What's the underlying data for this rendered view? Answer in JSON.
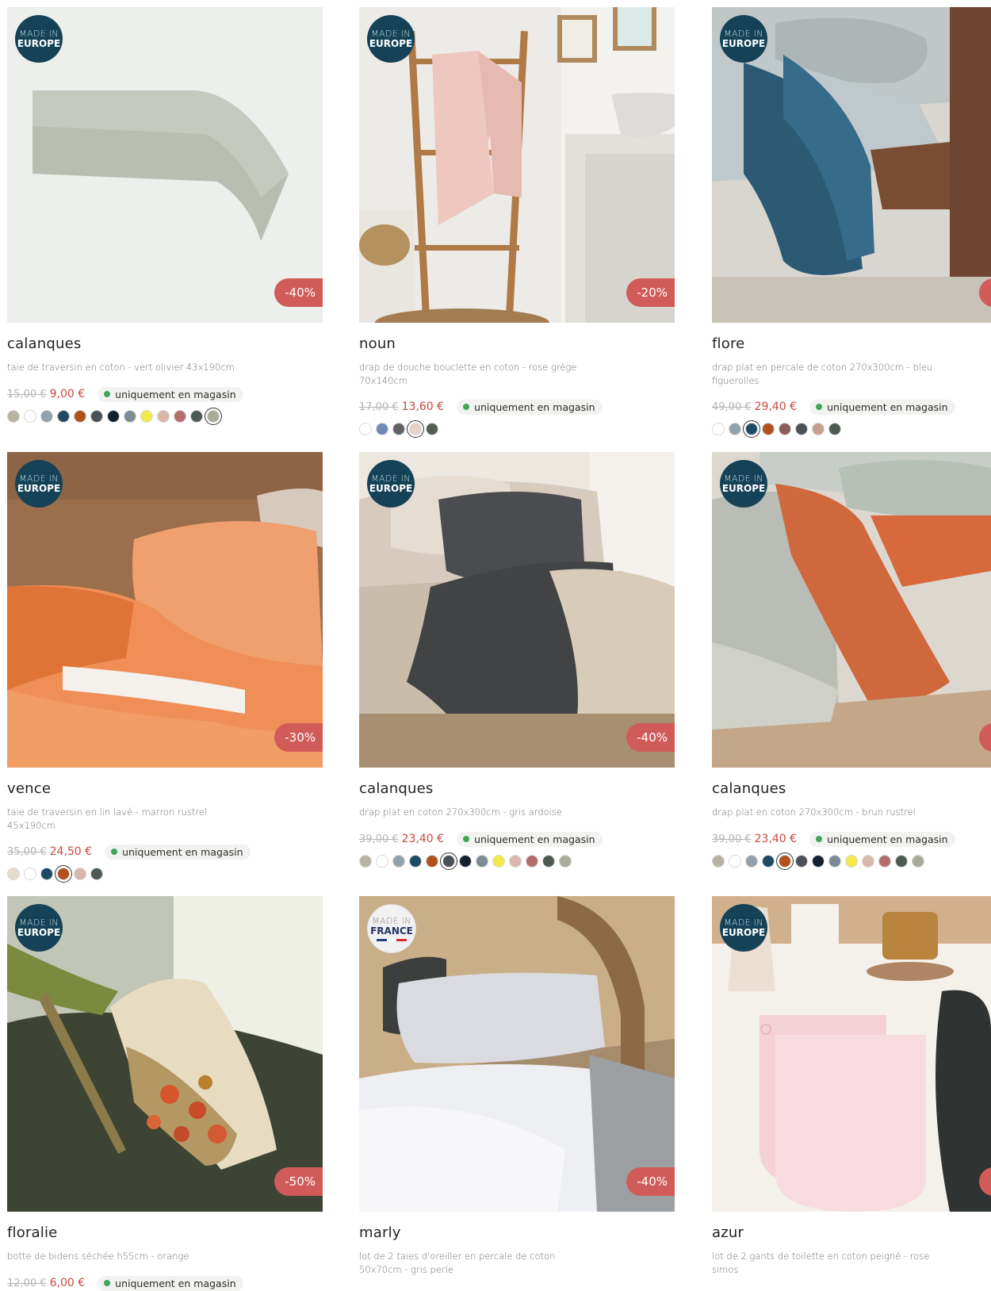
{
  "badges": {
    "europe": {
      "line1": "MADE IN",
      "line2": "EUROPE"
    },
    "france": {
      "line1": "MADE IN",
      "line2": "FRANCE"
    }
  },
  "stock_label": "uniquement en magasin",
  "products": [
    {
      "name": "calanques",
      "desc": "taie de traversin en coton - vert olivier 43x190cm",
      "old_price": "15,00 €",
      "new_price": "9,00 €",
      "discount": "-40%",
      "badge": "europe",
      "swatches": [
        "#b8b2a2",
        "#ffffff",
        "#93a1ab",
        "#1f4a66",
        "#b1511c",
        "#4c5058",
        "#13202e",
        "#7c8b94",
        "#f1e84b",
        "#d9b7ad",
        "#b56d6a",
        "#4d5a52",
        "#a9ac98"
      ],
      "selected": 12
    },
    {
      "name": "noun",
      "desc": "drap de douche bouclette en coton - rose grège 70x140cm",
      "old_price": "17,00 €",
      "new_price": "13,60 €",
      "discount": "-20%",
      "badge": "europe",
      "swatches": [
        "#ffffff",
        "#6f8ab3",
        "#616365",
        "#e7d3c8",
        "#545d52"
      ],
      "selected": 3
    },
    {
      "name": "flore",
      "desc": "drap plat en percale de coton 270x300cm - bleu figuerolles",
      "old_price": "49,00 €",
      "new_price": "29,40 €",
      "discount": "",
      "badge": "europe",
      "swatches": [
        "#ffffff",
        "#93a1ab",
        "#1f4a66",
        "#b1511c",
        "#8a5d59",
        "#4c5058",
        "#c7a08c",
        "#4d5a52"
      ],
      "selected": 2
    },
    {
      "name": "vence",
      "desc": "taie de traversin en lin lavé - marron rustrel 45x190cm",
      "old_price": "35,00 €",
      "new_price": "24,50 €",
      "discount": "-30%",
      "badge": "europe",
      "swatches": [
        "#e5dccb",
        "#ffffff",
        "#1f4a66",
        "#b1511c",
        "#d9b7ad",
        "#4d5a52"
      ],
      "selected": 3
    },
    {
      "name": "calanques",
      "desc": "drap plat en coton 270x300cm - gris ardoise",
      "old_price": "39,00 €",
      "new_price": "23,40 €",
      "discount": "-40%",
      "badge": "europe",
      "swatches": [
        "#b8b2a2",
        "#ffffff",
        "#93a1ab",
        "#1f4a66",
        "#b1511c",
        "#4c5058",
        "#13202e",
        "#7c8b94",
        "#f1e84b",
        "#d9b7ad",
        "#b56d6a",
        "#4d5a52",
        "#a9ac98"
      ],
      "selected": 5
    },
    {
      "name": "calanques",
      "desc": "drap plat en coton 270x300cm - brun rustrel",
      "old_price": "39,00 €",
      "new_price": "23,40 €",
      "discount": "",
      "badge": "europe",
      "swatches": [
        "#b8b2a2",
        "#ffffff",
        "#93a1ab",
        "#1f4a66",
        "#b1511c",
        "#4c5058",
        "#13202e",
        "#7c8b94",
        "#f1e84b",
        "#d9b7ad",
        "#b56d6a",
        "#4d5a52",
        "#a9ac98"
      ],
      "selected": 4
    },
    {
      "name": "floralie",
      "desc": "botte de bidens séchée h55cm - orange",
      "old_price": "12,00 €",
      "new_price": "6,00 €",
      "discount": "-50%",
      "badge": "europe",
      "swatches": [],
      "selected": -1
    },
    {
      "name": "marly",
      "desc": "lot de 2 taies d'oreiller en percale de coton 50x70cm - gris perle",
      "old_price": "",
      "new_price": "",
      "discount": "-40%",
      "badge": "france",
      "swatches": [],
      "selected": -1
    },
    {
      "name": "azur",
      "desc": "lot de 2 gants de toilette en coton peigné - rose simos",
      "old_price": "",
      "new_price": "",
      "discount": "",
      "badge": "europe",
      "swatches": [],
      "selected": -1
    }
  ]
}
